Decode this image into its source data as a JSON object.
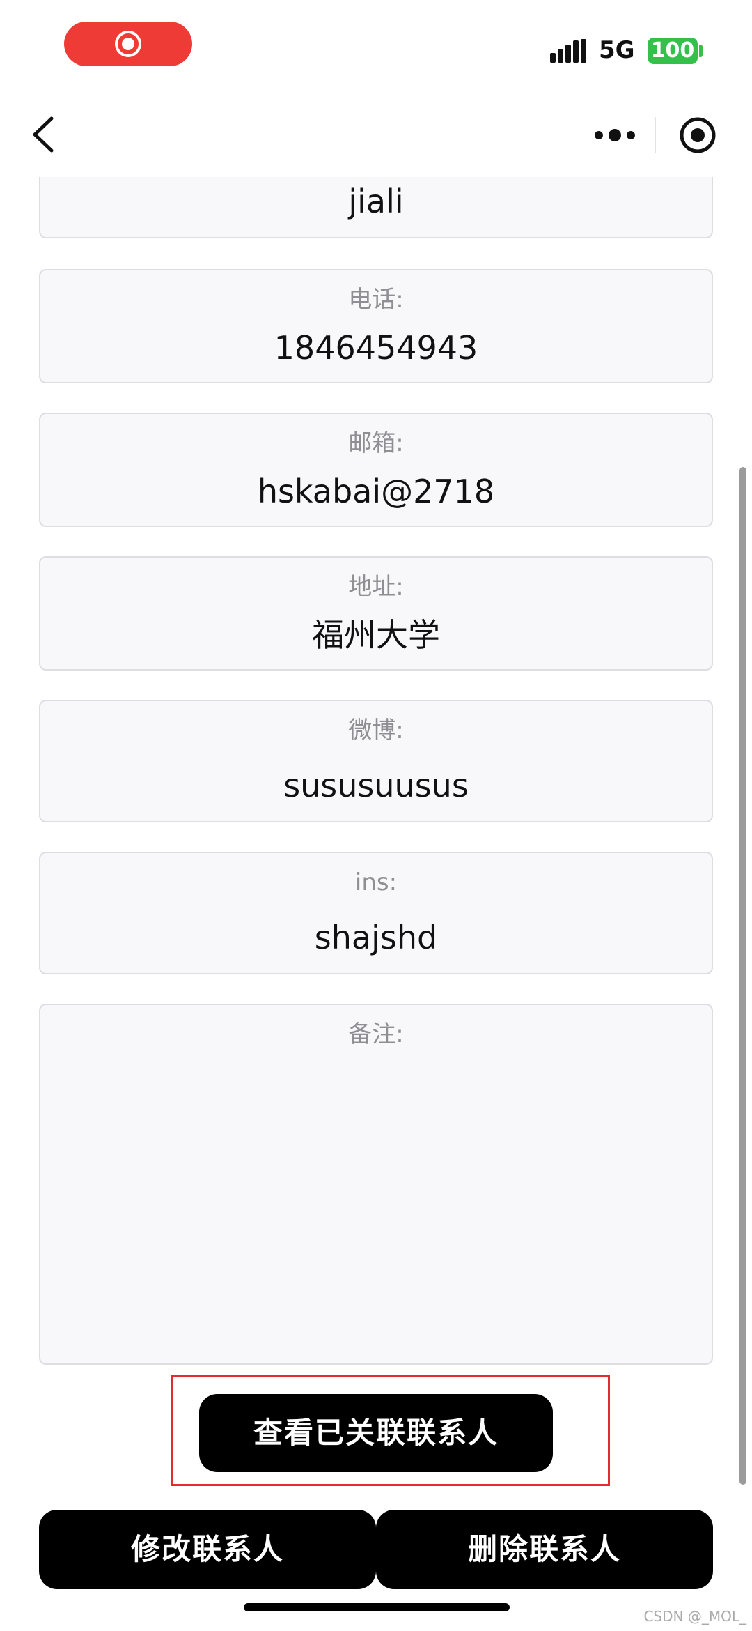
{
  "status_bar": {
    "network": "5G",
    "battery": "100",
    "colors": {
      "record_pill": "#ee3b36",
      "battery": "#35c04c"
    }
  },
  "nav": {
    "icons": [
      "back-chevron-icon",
      "more-dots-icon",
      "close-target-icon"
    ]
  },
  "contact": {
    "name_value": "jiali",
    "fields": [
      {
        "label": "电话:",
        "value": "1846454943"
      },
      {
        "label": "邮箱:",
        "value": "hskabai@2718"
      },
      {
        "label": "地址:",
        "value": "福州大学"
      },
      {
        "label": "微博:",
        "value": "sususuusus"
      },
      {
        "label": "ins:",
        "value": "shajshd"
      }
    ],
    "note": {
      "label": "备注:",
      "value": ""
    }
  },
  "actions": {
    "view_linked_label": "查看已关联联系人",
    "edit_label": "修改联系人",
    "delete_label": "删除联系人",
    "highlight_color": "#e02d2d"
  },
  "watermark": "CSDN @_MOL_"
}
